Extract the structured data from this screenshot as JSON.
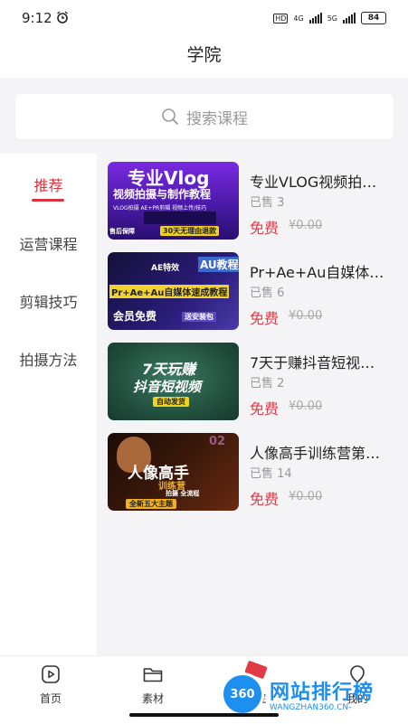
{
  "status_bar": {
    "time": "9:12",
    "network_1": "4G",
    "network_2": "5G",
    "battery": "84",
    "hd_label": "HD"
  },
  "header": {
    "title": "学院"
  },
  "search": {
    "placeholder": "搜索课程"
  },
  "sidebar": {
    "items": [
      {
        "label": "推荐",
        "active": true
      },
      {
        "label": "运营课程",
        "active": false
      },
      {
        "label": "剪辑技巧",
        "active": false
      },
      {
        "label": "拍摄方法",
        "active": false
      }
    ]
  },
  "courses": [
    {
      "title": "专业VLOG视频拍…",
      "sold": "已售 3",
      "price": "免费",
      "original_price": "¥0.00",
      "thumb": {
        "line1": "专业Vlog",
        "line2": "视频拍摄与制作教程",
        "line3": "VLOG拍摄 AE+PR剪辑 视频上传/技巧",
        "line4": "售后保障",
        "line5": "30天无理由退款",
        "colors": [
          "#6b1fd1",
          "#3a0f8a",
          "#f0d21a"
        ]
      }
    },
    {
      "title": "Pr+Ae+Au自媒体…",
      "sold": "已售 6",
      "price": "免费",
      "original_price": "¥0.00",
      "thumb": {
        "line1": "AE特效",
        "line2": "AU教程",
        "line3": "Pr+Ae+Au自媒体速成教程",
        "line4": "会员免费",
        "line5": "送安装包",
        "colors": [
          "#1a1040",
          "#3e2aa0",
          "#f2d22e"
        ]
      }
    },
    {
      "title": "7天于赚抖音短视…",
      "sold": "已售 2",
      "price": "免费",
      "original_price": "¥0.00",
      "thumb": {
        "line1": "7天玩赚",
        "line2": "抖音短视频",
        "line3": "自动发货",
        "colors": [
          "#1f4a3a",
          "#2f6a52",
          "#f0d21a"
        ]
      }
    },
    {
      "title": "人像高手训练营第…",
      "sold": "已售 14",
      "price": "免费",
      "original_price": "¥0.00",
      "thumb": {
        "line1": "人像高手",
        "line2": "训练营",
        "line3": "拍摄 全流程",
        "line4": "全新五大主题",
        "line5": "02",
        "colors": [
          "#2a1208",
          "#5a2410",
          "#f0b020"
        ]
      }
    }
  ],
  "tabbar": {
    "items": [
      {
        "label": "首页",
        "icon": "play-icon"
      },
      {
        "label": "素材",
        "icon": "folder-icon"
      },
      {
        "label": "学院",
        "icon": "academy-icon"
      },
      {
        "label": "我的",
        "icon": "profile-icon"
      }
    ]
  },
  "watermark": {
    "logo": "360",
    "title": "网站排行榜",
    "subtitle": "WANGZHAN360.CN-"
  }
}
